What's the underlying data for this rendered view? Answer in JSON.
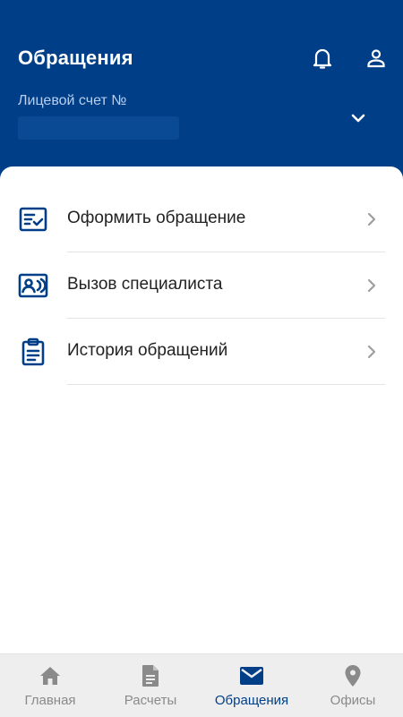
{
  "colors": {
    "brand": "#003f87",
    "header_text": "#ffffff",
    "subtle_header_text": "#b9cff0",
    "text": "#222222",
    "nav_inactive": "#8a8a8a",
    "nav_active": "#003f87",
    "chevron": "#9e9e9e"
  },
  "header": {
    "title": "Обращения",
    "account_label": "Лицевой счет №",
    "account_value": "",
    "icons": {
      "notifications": "bell-icon",
      "profile": "person-icon",
      "dropdown": "chevron-down-icon"
    }
  },
  "menu": {
    "items": [
      {
        "label": "Оформить обращение",
        "icon": "form-check-icon"
      },
      {
        "label": "Вызов специалиста",
        "icon": "contact-card-icon"
      },
      {
        "label": "История обращений",
        "icon": "clipboard-list-icon"
      }
    ]
  },
  "bottom_nav": {
    "active": "Обращения",
    "items": [
      {
        "label": "Главная",
        "icon": "home-icon"
      },
      {
        "label": "Расчеты",
        "icon": "document-icon"
      },
      {
        "label": "Обращения",
        "icon": "mail-icon"
      },
      {
        "label": "Офисы",
        "icon": "location-pin-icon"
      }
    ]
  }
}
